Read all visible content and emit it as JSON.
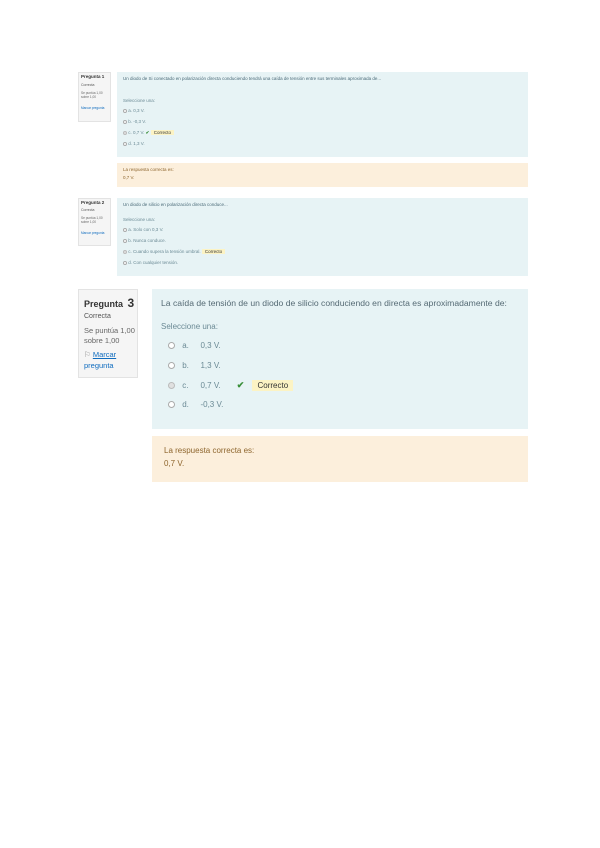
{
  "q1": {
    "title": "Pregunta 1",
    "status": "Correcta",
    "marks": "Se puntúa 1,00 sobre 1,00",
    "flag": "Marcar pregunta",
    "prompt": "Un diodo de Si conectado en polarización directa conduciendo tendrá una caída de tensión entre sus terminales aproximada de...",
    "select_label": "Seleccione una:",
    "options": [
      {
        "letter": "a.",
        "text": "0,3 V."
      },
      {
        "letter": "b.",
        "text": "-0,3 V."
      },
      {
        "letter": "c.",
        "text": "0,7 V."
      },
      {
        "letter": "d.",
        "text": "1,3 V."
      }
    ],
    "correct_badge": "Correcto",
    "feedback_label": "La respuesta correcta es:",
    "feedback_value": "0,7 V."
  },
  "q2": {
    "title": "Pregunta 2",
    "status": "Correcta",
    "marks": "Se puntúa 1,00 sobre 1,00",
    "flag": "Marcar pregunta",
    "prompt": "Un diodo de silicio en polarización directa conduce...",
    "select_label": "Seleccione una:",
    "options": [
      {
        "letter": "a.",
        "text": "Solo con 0,3 V."
      },
      {
        "letter": "b.",
        "text": "Nunca conduce."
      },
      {
        "letter": "c.",
        "text": "Cuando supera la tensión umbral."
      },
      {
        "letter": "d.",
        "text": "Con cualquier tensión."
      }
    ],
    "correct_badge": "Correcto"
  },
  "q3": {
    "title_prefix": "Pregunta",
    "title_number": "3",
    "status": "Correcta",
    "marks_line1": "Se puntúa 1,00",
    "marks_line2": "sobre 1,00",
    "flag_line1": "Marcar",
    "flag_line2": "pregunta",
    "prompt": "La caída de tensión de un diodo de silicio conduciendo en directa es aproximadamente de:",
    "select_label": "Seleccione una:",
    "options": [
      {
        "letter": "a.",
        "text": "0,3 V."
      },
      {
        "letter": "b.",
        "text": "1,3 V."
      },
      {
        "letter": "c.",
        "text": "0,7 V."
      },
      {
        "letter": "d.",
        "text": "-0,3 V."
      }
    ],
    "selected_index": 2,
    "correct_badge": "Correcto",
    "feedback_label": "La respuesta correcta es:",
    "feedback_value": "0,7 V."
  },
  "icons": {
    "check": "check-icon",
    "flag": "flag-icon",
    "radio": "radio-icon"
  },
  "colors": {
    "content_bg": "#e7f3f5",
    "feedback_bg": "#fcefdc",
    "badge_bg": "#fcf3c4",
    "link": "#0f6cbf",
    "check": "#3a8f3a"
  }
}
